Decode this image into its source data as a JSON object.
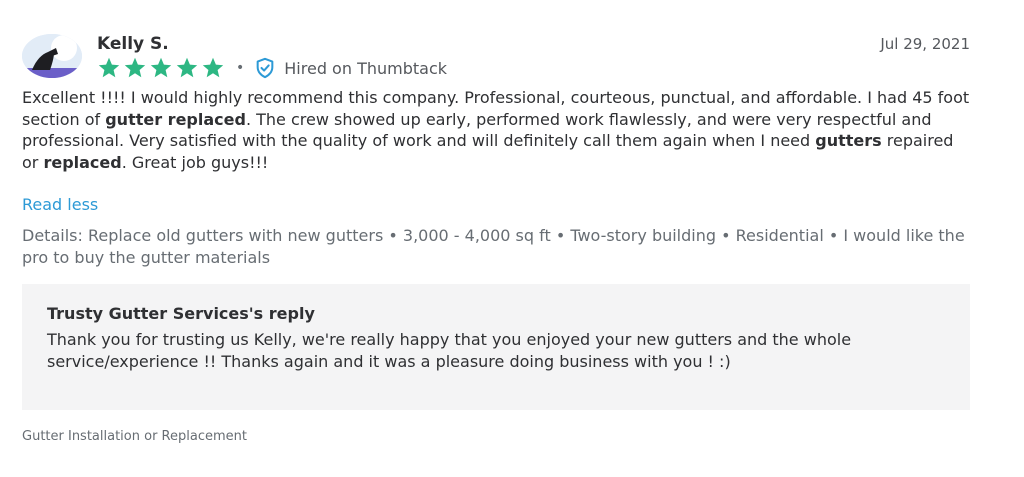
{
  "review": {
    "reviewer_name": "Kelly S.",
    "date": "Jul 29, 2021",
    "rating": 5,
    "rating_max": 5,
    "separator": "•",
    "hired_label": "Hired on Thumbtack",
    "body": {
      "p1": "Excellent !!!! I would highly recommend this company. Professional, courteous, punctual, and affordable. I had 45 foot section of ",
      "b1": "gutter replaced",
      "p2": ". The crew showed up early, performed work flawlessly, and were very respectful and professional. Very satisfied with the quality of work and will definitely call them again when I need ",
      "b2": "gutters",
      "p3": " repaired or ",
      "b3": "replaced",
      "p4": ". Great job guys!!!"
    },
    "read_less_label": "Read less",
    "details": "Details: Replace old gutters with new gutters • 3,000 - 4,000 sq ft • Two-story building • Residential • I would like the pro to buy the gutter materials",
    "reply": {
      "title": "Trusty Gutter Services's reply",
      "text": "Thank you for trusting us Kelly, we're really happy that you enjoyed your new gutters and the whole service/experience !! Thanks again and it was a pleasure doing business with you ! :)"
    },
    "category": "Gutter Installation or Replacement"
  },
  "colors": {
    "star": "#2db783",
    "verified_icon": "#2d9ad6",
    "link": "#2d9ad6",
    "reply_background": "#f4f4f5"
  },
  "icons": {
    "avatar": "avatar",
    "star": "star-icon",
    "verified": "shield-check-icon"
  }
}
